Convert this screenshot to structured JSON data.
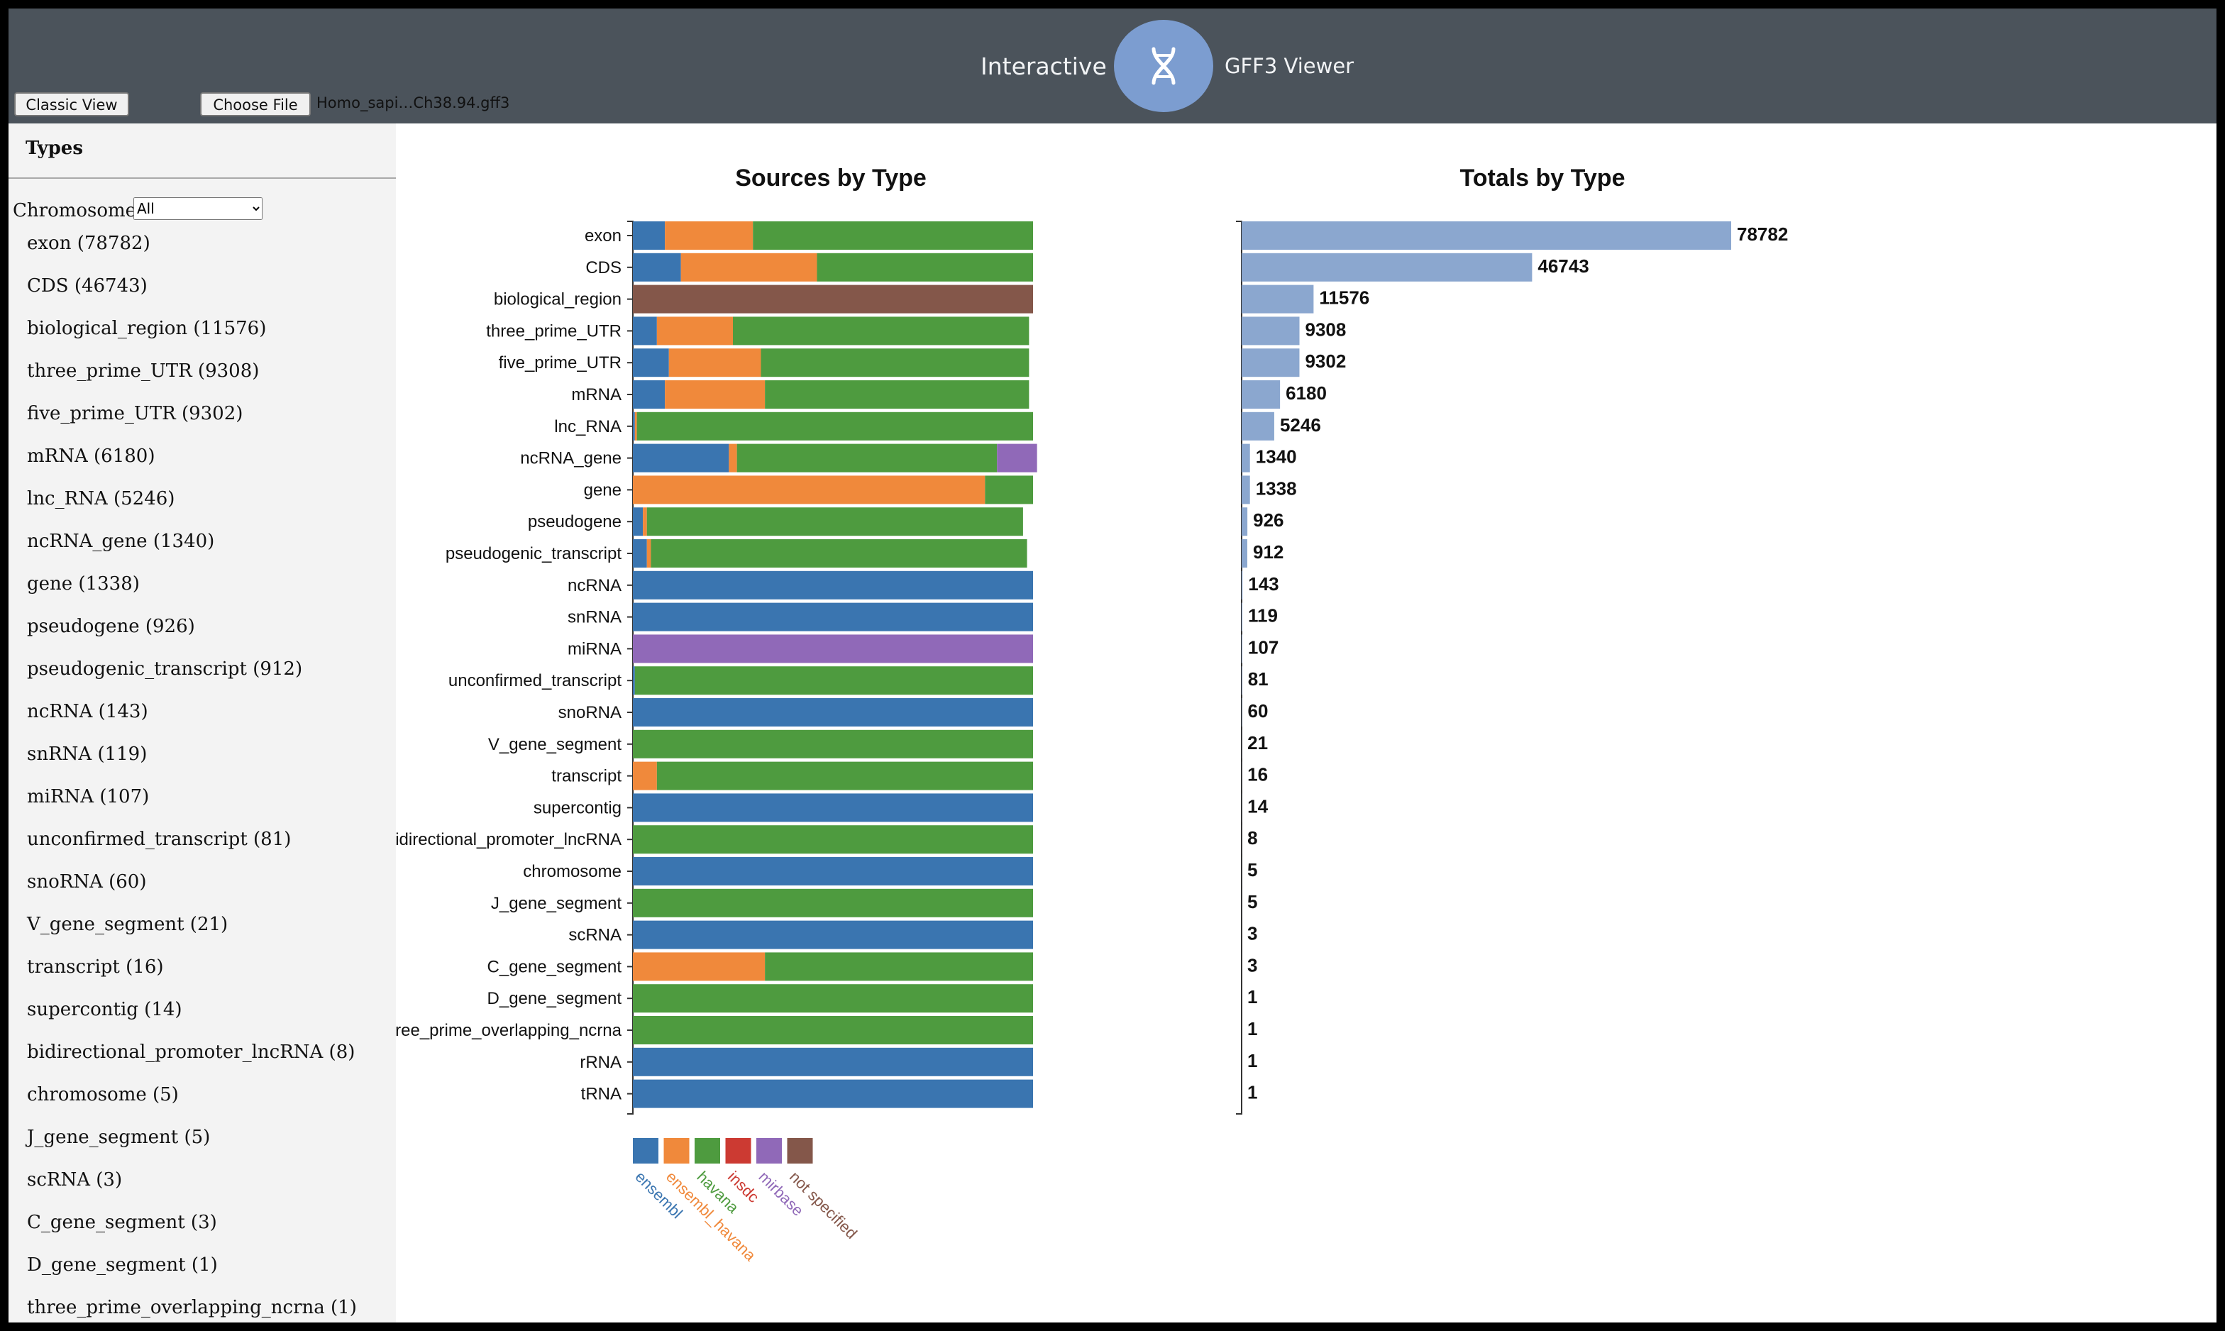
{
  "app": {
    "title_left": "Interactive",
    "title_right": "GFF3 Viewer",
    "logo_icon": "dna-icon",
    "classic_view_label": "Classic View",
    "choose_file_label": "Choose File",
    "file_name": "Homo_sapi…Ch38.94.gff3"
  },
  "sidebar": {
    "heading": "Types",
    "chromosome_label": "Chromosome:",
    "chromosome_selected": "All",
    "items": [
      {
        "label": "exon (78782)"
      },
      {
        "label": "CDS (46743)"
      },
      {
        "label": "biological_region (11576)"
      },
      {
        "label": "three_prime_UTR (9308)"
      },
      {
        "label": "five_prime_UTR (9302)"
      },
      {
        "label": "mRNA (6180)"
      },
      {
        "label": "lnc_RNA (5246)"
      },
      {
        "label": "ncRNA_gene (1340)"
      },
      {
        "label": "gene (1338)"
      },
      {
        "label": "pseudogene (926)"
      },
      {
        "label": "pseudogenic_transcript (912)"
      },
      {
        "label": "ncRNA (143)"
      },
      {
        "label": "snRNA (119)"
      },
      {
        "label": "miRNA (107)"
      },
      {
        "label": "unconfirmed_transcript (81)"
      },
      {
        "label": "snoRNA (60)"
      },
      {
        "label": "V_gene_segment (21)"
      },
      {
        "label": "transcript (16)"
      },
      {
        "label": "supercontig (14)"
      },
      {
        "label": "bidirectional_promoter_lncRNA (8)"
      },
      {
        "label": "chromosome (5)"
      },
      {
        "label": "J_gene_segment (5)"
      },
      {
        "label": "scRNA (3)"
      },
      {
        "label": "C_gene_segment (3)"
      },
      {
        "label": "D_gene_segment (1)"
      },
      {
        "label": "three_prime_overlapping_ncrna (1)"
      }
    ]
  },
  "chart_data": [
    {
      "type": "bar",
      "stacked": true,
      "orientation": "horizontal",
      "normalized": true,
      "title": "Sources by Type",
      "categories": [
        "exon",
        "CDS",
        "biological_region",
        "three_prime_UTR",
        "five_prime_UTR",
        "mRNA",
        "lnc_RNA",
        "ncRNA_gene",
        "gene",
        "pseudogene",
        "pseudogenic_transcript",
        "ncRNA",
        "snRNA",
        "miRNA",
        "unconfirmed_transcript",
        "snoRNA",
        "V_gene_segment",
        "transcript",
        "supercontig",
        "bidirectional_promoter_lncRNA",
        "chromosome",
        "J_gene_segment",
        "scRNA",
        "C_gene_segment",
        "D_gene_segment",
        "three_prime_overlapping_ncrna",
        "rRNA",
        "tRNA"
      ],
      "series": [
        {
          "name": "ensembl",
          "color": "#3a75b0",
          "values": [
            0.08,
            0.12,
            0,
            0.06,
            0.09,
            0.08,
            0.005,
            0.24,
            0,
            0.025,
            0.035,
            1,
            1,
            0,
            0.005,
            1,
            0,
            0,
            1,
            0,
            1,
            0,
            1,
            0,
            0,
            0,
            1,
            1
          ]
        },
        {
          "name": "ensembl_havana",
          "color": "#f0893b",
          "values": [
            0.22,
            0.34,
            0,
            0.19,
            0.23,
            0.25,
            0.005,
            0.02,
            0.88,
            0.01,
            0.01,
            0,
            0,
            0,
            0,
            0,
            0,
            0.06,
            0,
            0,
            0,
            0,
            0,
            0.33,
            0,
            0,
            0,
            0
          ]
        },
        {
          "name": "havana",
          "color": "#4e9b3f",
          "values": [
            0.7,
            0.54,
            0,
            0.74,
            0.67,
            0.66,
            0.99,
            0.65,
            0.12,
            0.94,
            0.94,
            0,
            0,
            0,
            0.995,
            0,
            1,
            0.94,
            0,
            1,
            0,
            1,
            0,
            0.67,
            1,
            1,
            0,
            0
          ]
        },
        {
          "name": "insdc",
          "color": "#cc3a32",
          "values": [
            0,
            0,
            0,
            0,
            0,
            0,
            0,
            0,
            0,
            0,
            0,
            0,
            0,
            0,
            0,
            0,
            0,
            0,
            0,
            0,
            0,
            0,
            0,
            0,
            0,
            0,
            0,
            0
          ]
        },
        {
          "name": "mirbase",
          "color": "#9069b8",
          "values": [
            0,
            0,
            0,
            0,
            0,
            0,
            0,
            0.1,
            0,
            0,
            0,
            0,
            0,
            1,
            0,
            0,
            0,
            0,
            0,
            0,
            0,
            0,
            0,
            0,
            0,
            0,
            0,
            0
          ]
        },
        {
          "name": "not specified",
          "color": "#84574a",
          "values": [
            0,
            0,
            1,
            0,
            0,
            0,
            0,
            0,
            0,
            0,
            0,
            0,
            0,
            0,
            0,
            0,
            0,
            0,
            0,
            0,
            0,
            0,
            0,
            0,
            0,
            0,
            0,
            0
          ]
        }
      ]
    },
    {
      "type": "bar",
      "orientation": "horizontal",
      "title": "Totals by Type",
      "color": "#8ba7cf",
      "categories": [
        "exon",
        "CDS",
        "biological_region",
        "three_prime_UTR",
        "five_prime_UTR",
        "mRNA",
        "lnc_RNA",
        "ncRNA_gene",
        "gene",
        "pseudogene",
        "pseudogenic_transcript",
        "ncRNA",
        "snRNA",
        "miRNA",
        "unconfirmed_transcript",
        "snoRNA",
        "V_gene_segment",
        "transcript",
        "supercontig",
        "bidirectional_promoter_lncRNA",
        "chromosome",
        "J_gene_segment",
        "scRNA",
        "C_gene_segment",
        "D_gene_segment",
        "three_prime_overlapping_ncrna",
        "rRNA",
        "tRNA"
      ],
      "values": [
        78782,
        46743,
        11576,
        9308,
        9302,
        6180,
        5246,
        1340,
        1338,
        926,
        912,
        143,
        119,
        107,
        81,
        60,
        21,
        16,
        14,
        8,
        5,
        5,
        3,
        3,
        1,
        1,
        1,
        1
      ]
    }
  ]
}
